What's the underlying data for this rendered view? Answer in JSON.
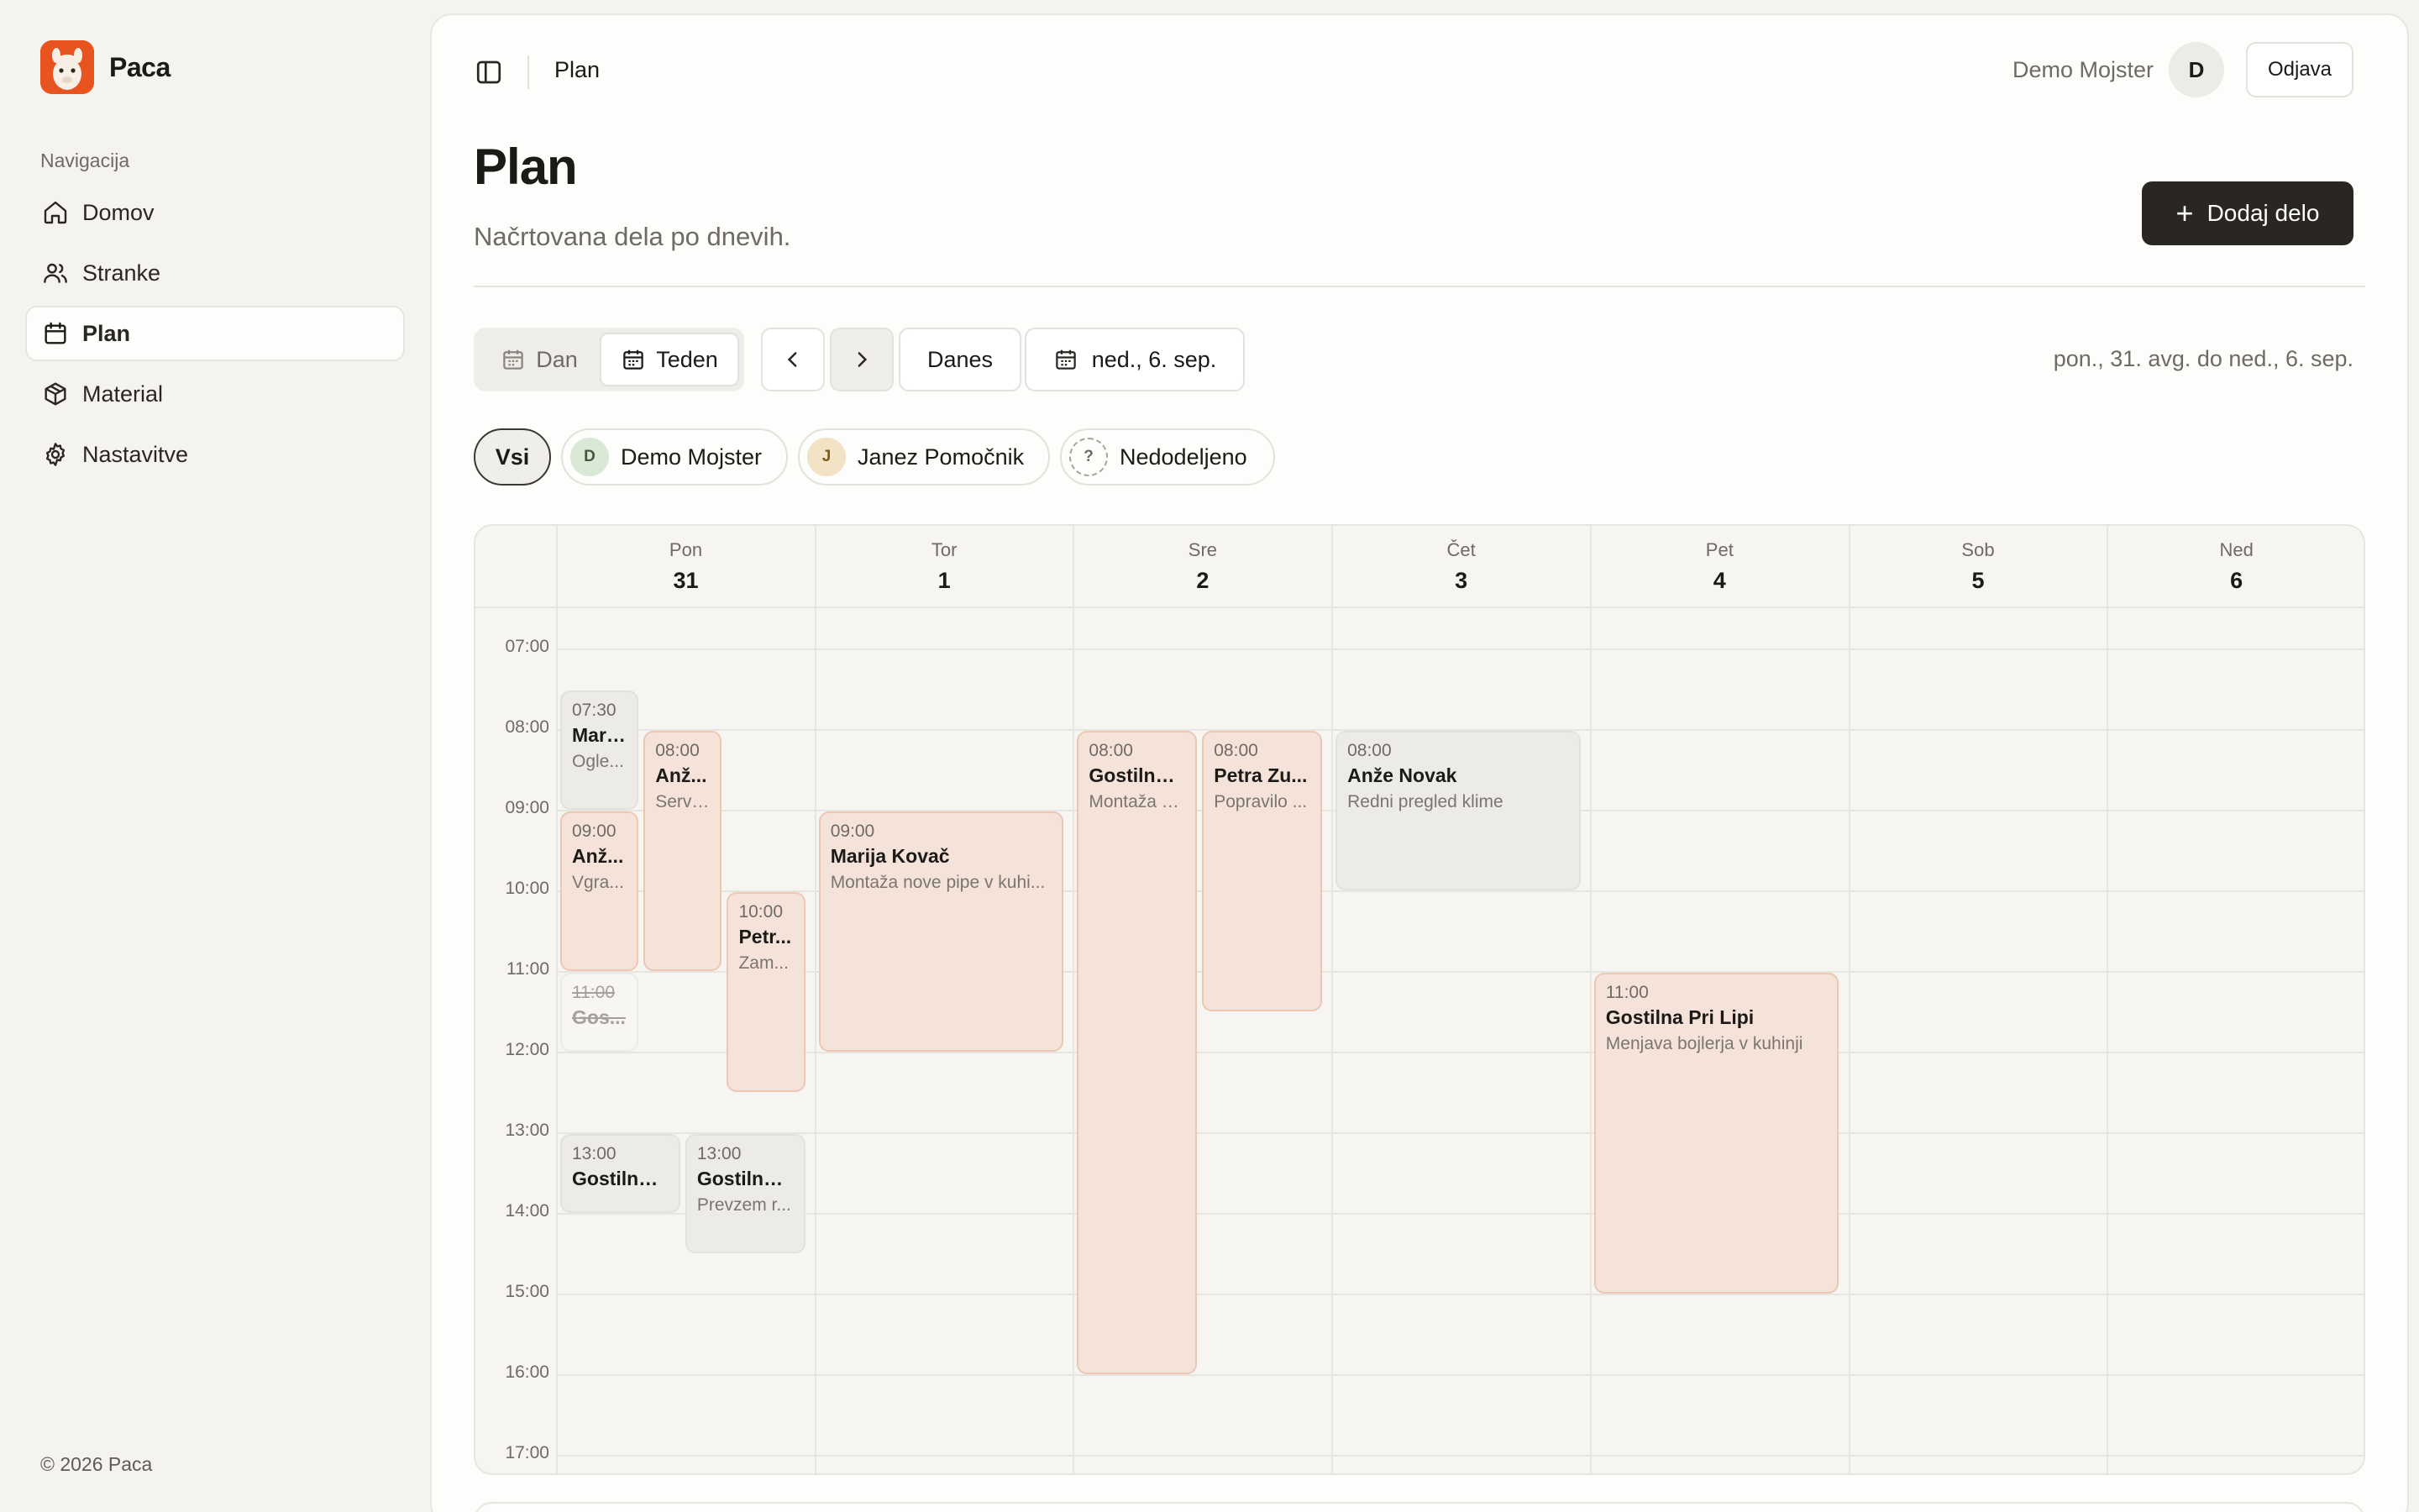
{
  "app": {
    "name": "Paca",
    "copyright": "© 2026 Paca"
  },
  "sidebar": {
    "caption": "Navigacija",
    "items": [
      {
        "label": "Domov",
        "icon": "home-icon"
      },
      {
        "label": "Stranke",
        "icon": "users-icon"
      },
      {
        "label": "Plan",
        "icon": "calendar-icon",
        "active": true
      },
      {
        "label": "Material",
        "icon": "package-icon"
      },
      {
        "label": "Nastavitve",
        "icon": "gear-icon"
      }
    ]
  },
  "header": {
    "breadcrumb": "Plan",
    "user_name": "Demo Mojster",
    "avatar_initial": "D",
    "logout_label": "Odjava"
  },
  "page": {
    "title": "Plan",
    "subtitle": "Načrtovana dela po dnevih.",
    "add_button": "Dodaj delo"
  },
  "toolbar": {
    "view_day": "Dan",
    "view_week": "Teden",
    "today": "Danes",
    "date": "ned., 6. sep.",
    "range": "pon., 31. avg. do ned., 6. sep."
  },
  "filters": {
    "all": "Vsi",
    "people": [
      {
        "initial": "D",
        "name": "Demo Mojster"
      },
      {
        "initial": "J",
        "name": "Janez Pomočnik"
      },
      {
        "initial": "?",
        "name": "Nedodeljeno"
      }
    ]
  },
  "calendar": {
    "days": [
      {
        "name": "Pon",
        "date": "31"
      },
      {
        "name": "Tor",
        "date": "1"
      },
      {
        "name": "Sre",
        "date": "2"
      },
      {
        "name": "Čet",
        "date": "3"
      },
      {
        "name": "Pet",
        "date": "4"
      },
      {
        "name": "Sob",
        "date": "5"
      },
      {
        "name": "Ned",
        "date": "6"
      }
    ],
    "hours": [
      "07:00",
      "08:00",
      "09:00",
      "10:00",
      "11:00",
      "12:00",
      "13:00",
      "14:00",
      "15:00",
      "16:00",
      "17:00"
    ],
    "events": [
      {
        "day": 0,
        "time": "07:30",
        "title": "Mari...",
        "desc": "Ogle...",
        "start": 7.5,
        "end": 9,
        "style": "gray",
        "lane": 0,
        "lanes": 3
      },
      {
        "day": 0,
        "time": "09:00",
        "title": "Anž...",
        "desc": "Vgra...",
        "start": 9,
        "end": 11,
        "style": "peach",
        "lane": 0,
        "lanes": 3
      },
      {
        "day": 0,
        "time": "11:00",
        "title": "Gos...",
        "desc": "",
        "start": 11,
        "end": 12,
        "style": "cancel",
        "lane": 0,
        "lanes": 3
      },
      {
        "day": 0,
        "time": "08:00",
        "title": "Anž...",
        "desc": "Servi...",
        "start": 8,
        "end": 11,
        "style": "peach",
        "lane": 1,
        "lanes": 3
      },
      {
        "day": 0,
        "time": "10:00",
        "title": "Petr...",
        "desc": "Zam...",
        "start": 10,
        "end": 12.5,
        "style": "peach",
        "lane": 2,
        "lanes": 3
      },
      {
        "day": 0,
        "time": "13:00",
        "title": "Gostilna ...",
        "desc": "",
        "start": 13,
        "end": 14,
        "style": "gray",
        "lane": 0,
        "lanes": 2
      },
      {
        "day": 0,
        "time": "13:00",
        "title": "Gostilna ...",
        "desc": "Prevzem r...",
        "start": 13,
        "end": 14.5,
        "style": "gray",
        "lane": 1,
        "lanes": 2
      },
      {
        "day": 1,
        "time": "09:00",
        "title": "Marija Kovač",
        "desc": "Montaža nove pipe v kuhi...",
        "start": 9,
        "end": 12,
        "style": "peach",
        "lane": 0,
        "lanes": 1
      },
      {
        "day": 2,
        "time": "08:00",
        "title": "Gostilna ...",
        "desc": "Montaža n...",
        "start": 8,
        "end": 16,
        "style": "peach",
        "lane": 0,
        "lanes": 2
      },
      {
        "day": 2,
        "time": "08:00",
        "title": "Petra Zu...",
        "desc": "Popravilo ...",
        "start": 8,
        "end": 11.5,
        "style": "peach",
        "lane": 1,
        "lanes": 2
      },
      {
        "day": 3,
        "time": "08:00",
        "title": "Anže Novak",
        "desc": "Redni pregled klime",
        "start": 8,
        "end": 10,
        "style": "gray",
        "lane": 0,
        "lanes": 1
      },
      {
        "day": 4,
        "time": "11:00",
        "title": "Gostilna Pri Lipi",
        "desc": "Menjava bojlerja v kuhinji",
        "start": 11,
        "end": 15,
        "style": "peach",
        "lane": 0,
        "lanes": 1
      }
    ]
  }
}
